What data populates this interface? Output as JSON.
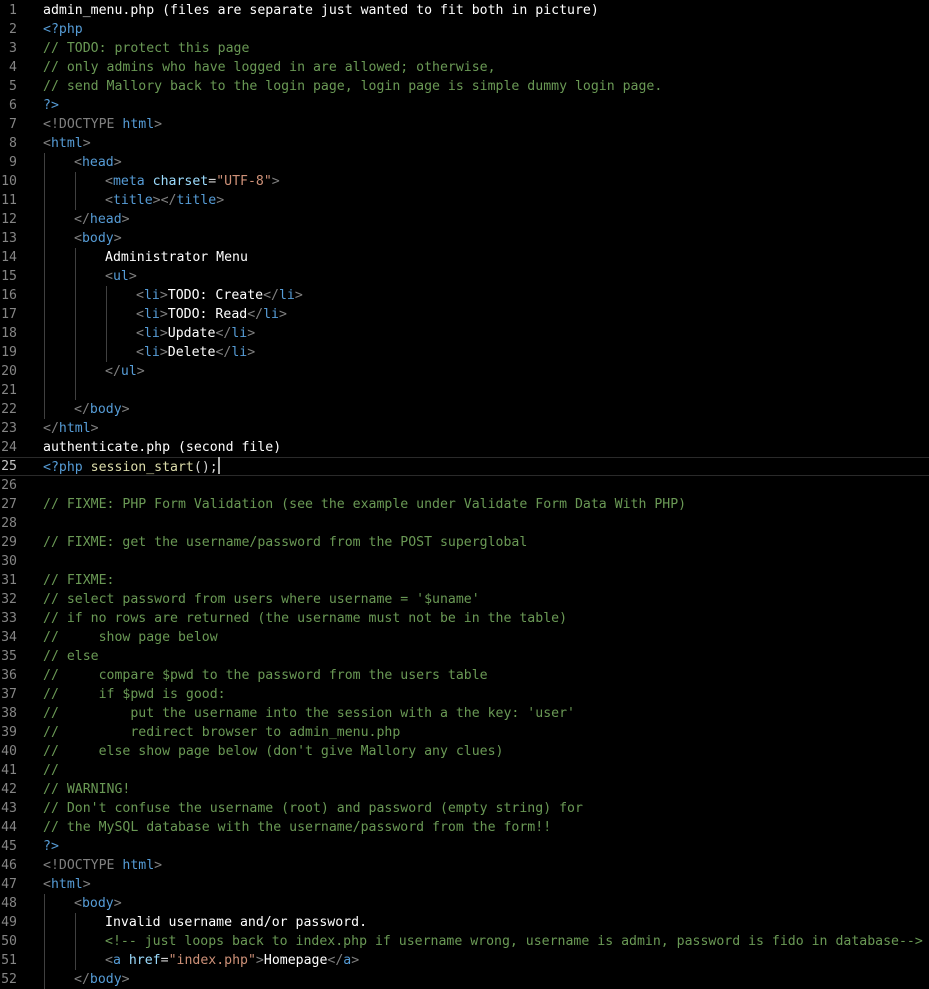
{
  "editor": {
    "current_line": 25,
    "colors": {
      "background": "#000000",
      "line_number": "#858585",
      "comment": "#6a9955",
      "keyword": "#569cd6",
      "string": "#ce9178",
      "attribute": "#9cdcfe",
      "plain_text": "#ffffff"
    },
    "lines": [
      {
        "number": 1,
        "indent": 0,
        "segments": [
          {
            "t": "admin_menu.php (files are separate just wanted to fit both in picture)",
            "c": "text"
          }
        ]
      },
      {
        "number": 2,
        "indent": 0,
        "segments": [
          {
            "t": "<?php",
            "c": "php"
          }
        ]
      },
      {
        "number": 3,
        "indent": 0,
        "segments": [
          {
            "t": "// TODO: protect this page",
            "c": "comment"
          }
        ]
      },
      {
        "number": 4,
        "indent": 0,
        "segments": [
          {
            "t": "// only admins who have logged in are allowed; otherwise,",
            "c": "comment"
          }
        ]
      },
      {
        "number": 5,
        "indent": 0,
        "segments": [
          {
            "t": "// send Mallory back to the login page, login page is simple dummy login page.",
            "c": "comment"
          }
        ]
      },
      {
        "number": 6,
        "indent": 0,
        "segments": [
          {
            "t": "?>",
            "c": "php"
          }
        ]
      },
      {
        "number": 7,
        "indent": 0,
        "segments": [
          {
            "t": "<!DOCTYPE ",
            "c": "tag"
          },
          {
            "t": "html",
            "c": "tagname"
          },
          {
            "t": ">",
            "c": "tag"
          }
        ]
      },
      {
        "number": 8,
        "indent": 0,
        "segments": [
          {
            "t": "<",
            "c": "tag"
          },
          {
            "t": "html",
            "c": "tagname"
          },
          {
            "t": ">",
            "c": "tag"
          }
        ]
      },
      {
        "number": 9,
        "indent": 1,
        "segments": [
          {
            "t": "<",
            "c": "tag"
          },
          {
            "t": "head",
            "c": "tagname"
          },
          {
            "t": ">",
            "c": "tag"
          }
        ]
      },
      {
        "number": 10,
        "indent": 2,
        "segments": [
          {
            "t": "<",
            "c": "tag"
          },
          {
            "t": "meta",
            "c": "tagname"
          },
          {
            "t": " ",
            "c": "punct"
          },
          {
            "t": "charset",
            "c": "attr"
          },
          {
            "t": "=",
            "c": "punct"
          },
          {
            "t": "\"UTF-8\"",
            "c": "str"
          },
          {
            "t": ">",
            "c": "tag"
          }
        ]
      },
      {
        "number": 11,
        "indent": 2,
        "segments": [
          {
            "t": "<",
            "c": "tag"
          },
          {
            "t": "title",
            "c": "tagname"
          },
          {
            "t": "></",
            "c": "tag"
          },
          {
            "t": "title",
            "c": "tagname"
          },
          {
            "t": ">",
            "c": "tag"
          }
        ]
      },
      {
        "number": 12,
        "indent": 1,
        "segments": [
          {
            "t": "</",
            "c": "tag"
          },
          {
            "t": "head",
            "c": "tagname"
          },
          {
            "t": ">",
            "c": "tag"
          }
        ]
      },
      {
        "number": 13,
        "indent": 1,
        "segments": [
          {
            "t": "<",
            "c": "tag"
          },
          {
            "t": "body",
            "c": "tagname"
          },
          {
            "t": ">",
            "c": "tag"
          }
        ]
      },
      {
        "number": 14,
        "indent": 2,
        "segments": [
          {
            "t": "Administrator Menu",
            "c": "text"
          }
        ]
      },
      {
        "number": 15,
        "indent": 2,
        "segments": [
          {
            "t": "<",
            "c": "tag"
          },
          {
            "t": "ul",
            "c": "tagname"
          },
          {
            "t": ">",
            "c": "tag"
          }
        ]
      },
      {
        "number": 16,
        "indent": 3,
        "segments": [
          {
            "t": "<",
            "c": "tag"
          },
          {
            "t": "li",
            "c": "tagname"
          },
          {
            "t": ">",
            "c": "tag"
          },
          {
            "t": "TODO: Create",
            "c": "text"
          },
          {
            "t": "</",
            "c": "tag"
          },
          {
            "t": "li",
            "c": "tagname"
          },
          {
            "t": ">",
            "c": "tag"
          }
        ]
      },
      {
        "number": 17,
        "indent": 3,
        "segments": [
          {
            "t": "<",
            "c": "tag"
          },
          {
            "t": "li",
            "c": "tagname"
          },
          {
            "t": ">",
            "c": "tag"
          },
          {
            "t": "TODO: Read",
            "c": "text"
          },
          {
            "t": "</",
            "c": "tag"
          },
          {
            "t": "li",
            "c": "tagname"
          },
          {
            "t": ">",
            "c": "tag"
          }
        ]
      },
      {
        "number": 18,
        "indent": 3,
        "segments": [
          {
            "t": "<",
            "c": "tag"
          },
          {
            "t": "li",
            "c": "tagname"
          },
          {
            "t": ">",
            "c": "tag"
          },
          {
            "t": "Update",
            "c": "text"
          },
          {
            "t": "</",
            "c": "tag"
          },
          {
            "t": "li",
            "c": "tagname"
          },
          {
            "t": ">",
            "c": "tag"
          }
        ]
      },
      {
        "number": 19,
        "indent": 3,
        "segments": [
          {
            "t": "<",
            "c": "tag"
          },
          {
            "t": "li",
            "c": "tagname"
          },
          {
            "t": ">",
            "c": "tag"
          },
          {
            "t": "Delete",
            "c": "text"
          },
          {
            "t": "</",
            "c": "tag"
          },
          {
            "t": "li",
            "c": "tagname"
          },
          {
            "t": ">",
            "c": "tag"
          }
        ]
      },
      {
        "number": 20,
        "indent": 2,
        "segments": [
          {
            "t": "</",
            "c": "tag"
          },
          {
            "t": "ul",
            "c": "tagname"
          },
          {
            "t": ">",
            "c": "tag"
          }
        ]
      },
      {
        "number": 21,
        "indent": 2,
        "segments": []
      },
      {
        "number": 22,
        "indent": 1,
        "segments": [
          {
            "t": "</",
            "c": "tag"
          },
          {
            "t": "body",
            "c": "tagname"
          },
          {
            "t": ">",
            "c": "tag"
          }
        ]
      },
      {
        "number": 23,
        "indent": 0,
        "segments": [
          {
            "t": "</",
            "c": "tag"
          },
          {
            "t": "html",
            "c": "tagname"
          },
          {
            "t": ">",
            "c": "tag"
          }
        ]
      },
      {
        "number": 24,
        "indent": 0,
        "segments": [
          {
            "t": "authenticate.php (second file)",
            "c": "text"
          }
        ]
      },
      {
        "number": 25,
        "indent": 0,
        "segments": [
          {
            "t": "<?php",
            "c": "php"
          },
          {
            "t": " ",
            "c": "punct"
          },
          {
            "t": "session_start",
            "c": "fn"
          },
          {
            "t": "();",
            "c": "punct"
          }
        ],
        "caret": true
      },
      {
        "number": 26,
        "indent": 0,
        "segments": []
      },
      {
        "number": 27,
        "indent": 0,
        "segments": [
          {
            "t": "// FIXME: PHP Form Validation (see the example under Validate Form Data With PHP)",
            "c": "comment"
          }
        ]
      },
      {
        "number": 28,
        "indent": 0,
        "segments": []
      },
      {
        "number": 29,
        "indent": 0,
        "segments": [
          {
            "t": "// FIXME: get the username/password from the POST superglobal",
            "c": "comment"
          }
        ]
      },
      {
        "number": 30,
        "indent": 0,
        "segments": []
      },
      {
        "number": 31,
        "indent": 0,
        "segments": [
          {
            "t": "// FIXME:",
            "c": "comment"
          }
        ]
      },
      {
        "number": 32,
        "indent": 0,
        "segments": [
          {
            "t": "// select password from users where username = '$uname'",
            "c": "comment"
          }
        ]
      },
      {
        "number": 33,
        "indent": 0,
        "segments": [
          {
            "t": "// if no rows are returned (the username must not be in the table)",
            "c": "comment"
          }
        ]
      },
      {
        "number": 34,
        "indent": 0,
        "segments": [
          {
            "t": "//     show page below",
            "c": "comment"
          }
        ]
      },
      {
        "number": 35,
        "indent": 0,
        "segments": [
          {
            "t": "// else",
            "c": "comment"
          }
        ]
      },
      {
        "number": 36,
        "indent": 0,
        "segments": [
          {
            "t": "//     compare $pwd to the password from the users table",
            "c": "comment"
          }
        ]
      },
      {
        "number": 37,
        "indent": 0,
        "segments": [
          {
            "t": "//     if $pwd is good:",
            "c": "comment"
          }
        ]
      },
      {
        "number": 38,
        "indent": 0,
        "segments": [
          {
            "t": "//         put the username into the session with a the key: 'user'",
            "c": "comment"
          }
        ]
      },
      {
        "number": 39,
        "indent": 0,
        "segments": [
          {
            "t": "//         redirect browser to admin_menu.php",
            "c": "comment"
          }
        ]
      },
      {
        "number": 40,
        "indent": 0,
        "segments": [
          {
            "t": "//     else show page below (don't give Mallory any clues)",
            "c": "comment"
          }
        ]
      },
      {
        "number": 41,
        "indent": 0,
        "segments": [
          {
            "t": "//",
            "c": "comment"
          }
        ]
      },
      {
        "number": 42,
        "indent": 0,
        "segments": [
          {
            "t": "// WARNING!",
            "c": "comment"
          }
        ]
      },
      {
        "number": 43,
        "indent": 0,
        "segments": [
          {
            "t": "// Don't confuse the username (root) and password (empty string) for",
            "c": "comment"
          }
        ]
      },
      {
        "number": 44,
        "indent": 0,
        "segments": [
          {
            "t": "// the MySQL database with the username/password from the form!!",
            "c": "comment"
          }
        ]
      },
      {
        "number": 45,
        "indent": 0,
        "segments": [
          {
            "t": "?>",
            "c": "php"
          }
        ]
      },
      {
        "number": 46,
        "indent": 0,
        "segments": [
          {
            "t": "<!DOCTYPE ",
            "c": "tag"
          },
          {
            "t": "html",
            "c": "tagname"
          },
          {
            "t": ">",
            "c": "tag"
          }
        ]
      },
      {
        "number": 47,
        "indent": 0,
        "segments": [
          {
            "t": "<",
            "c": "tag"
          },
          {
            "t": "html",
            "c": "tagname"
          },
          {
            "t": ">",
            "c": "tag"
          }
        ]
      },
      {
        "number": 48,
        "indent": 1,
        "segments": [
          {
            "t": "<",
            "c": "tag"
          },
          {
            "t": "body",
            "c": "tagname"
          },
          {
            "t": ">",
            "c": "tag"
          }
        ]
      },
      {
        "number": 49,
        "indent": 2,
        "segments": [
          {
            "t": "Invalid username and/or password.",
            "c": "text"
          }
        ]
      },
      {
        "number": 50,
        "indent": 2,
        "segments": [
          {
            "t": "<!-- just loops back to index.php if username wrong, username is admin, password is fido in database-->",
            "c": "comment"
          }
        ]
      },
      {
        "number": 51,
        "indent": 2,
        "segments": [
          {
            "t": "<",
            "c": "tag"
          },
          {
            "t": "a",
            "c": "tagname"
          },
          {
            "t": " ",
            "c": "punct"
          },
          {
            "t": "href",
            "c": "attr"
          },
          {
            "t": "=",
            "c": "punct"
          },
          {
            "t": "\"index.php\"",
            "c": "str"
          },
          {
            "t": ">",
            "c": "tag"
          },
          {
            "t": "Homepage",
            "c": "text"
          },
          {
            "t": "</",
            "c": "tag"
          },
          {
            "t": "a",
            "c": "tagname"
          },
          {
            "t": ">",
            "c": "tag"
          }
        ]
      },
      {
        "number": 52,
        "indent": 1,
        "segments": [
          {
            "t": "</",
            "c": "tag"
          },
          {
            "t": "body",
            "c": "tagname"
          },
          {
            "t": ">",
            "c": "tag"
          }
        ]
      }
    ]
  }
}
